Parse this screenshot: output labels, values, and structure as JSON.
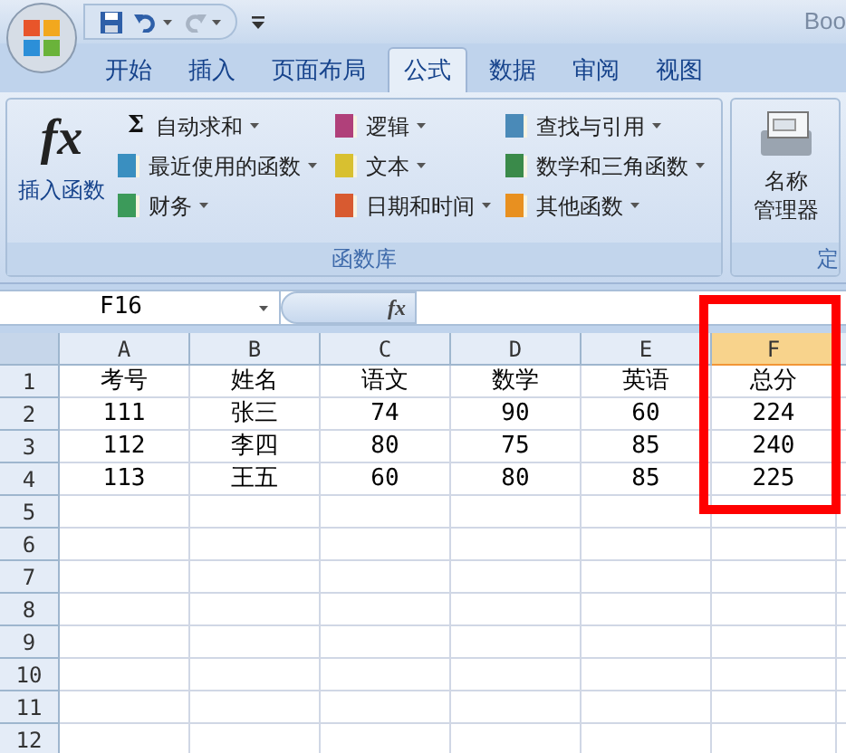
{
  "title": "Boo",
  "quick_access": [
    {
      "kind": "save",
      "disabled": false
    },
    {
      "kind": "undo",
      "disabled": false
    },
    {
      "kind": "redo",
      "disabled": true
    }
  ],
  "tabs": [
    {
      "label": "开始",
      "selected": false
    },
    {
      "label": "插入",
      "selected": false
    },
    {
      "label": "页面布局",
      "selected": false
    },
    {
      "label": "公式",
      "selected": true
    },
    {
      "label": "数据",
      "selected": false
    },
    {
      "label": "审阅",
      "selected": false
    },
    {
      "label": "视图",
      "selected": false
    }
  ],
  "ribbon": {
    "groups": [
      {
        "label": "函数库",
        "large_button": {
          "kind": "fx",
          "icon_text": "fx",
          "label": "插入函数"
        },
        "columns": [
          [
            {
              "kind": "sigma",
              "icon_text": "Σ",
              "label": "自动求和",
              "dropdown": true
            },
            {
              "kind": "book",
              "color": "#3a8fc0",
              "label": "最近使用的函数",
              "dropdown": true
            },
            {
              "kind": "book",
              "color": "#3c9a5a",
              "label": "财务",
              "dropdown": true
            }
          ],
          [
            {
              "kind": "book",
              "color": "#b0407a",
              "label": "逻辑",
              "dropdown": true
            },
            {
              "kind": "book",
              "color": "#d8c030",
              "label": "文本",
              "dropdown": true
            },
            {
              "kind": "book",
              "color": "#d85a30",
              "label": "日期和时间",
              "dropdown": true
            }
          ],
          [
            {
              "kind": "book",
              "color": "#4a8ab8",
              "label": "查找与引用",
              "dropdown": true
            },
            {
              "kind": "book",
              "color": "#3a8a4a",
              "label": "数学和三角函数",
              "dropdown": true
            },
            {
              "kind": "book",
              "color": "#e89020",
              "label": "其他函数",
              "dropdown": true
            }
          ]
        ]
      },
      {
        "label": "定",
        "large_button": {
          "kind": "names",
          "label_lines": [
            "名称",
            "管理器"
          ]
        }
      }
    ]
  },
  "formula_bar": {
    "name_box": "F16",
    "fx_label": "fx"
  },
  "sheet": {
    "columns": [
      {
        "label": "A",
        "selected": false
      },
      {
        "label": "B",
        "selected": false
      },
      {
        "label": "C",
        "selected": false
      },
      {
        "label": "D",
        "selected": false
      },
      {
        "label": "E",
        "selected": false
      },
      {
        "label": "F",
        "selected": true
      }
    ],
    "rows": [
      {
        "header": "1",
        "cells": [
          "考号",
          "姓名",
          "语文",
          "数学",
          "英语",
          "总分"
        ]
      },
      {
        "header": "2",
        "cells": [
          "111",
          "张三",
          "74",
          "90",
          "60",
          "224"
        ]
      },
      {
        "header": "3",
        "cells": [
          "112",
          "李四",
          "80",
          "75",
          "85",
          "240"
        ]
      },
      {
        "header": "4",
        "cells": [
          "113",
          "王五",
          "60",
          "80",
          "85",
          "225"
        ]
      },
      {
        "header": "5"
      },
      {
        "header": "6"
      },
      {
        "header": "7"
      },
      {
        "header": "8"
      },
      {
        "header": "9"
      },
      {
        "header": "10"
      },
      {
        "header": "11"
      },
      {
        "header": "12"
      }
    ]
  }
}
